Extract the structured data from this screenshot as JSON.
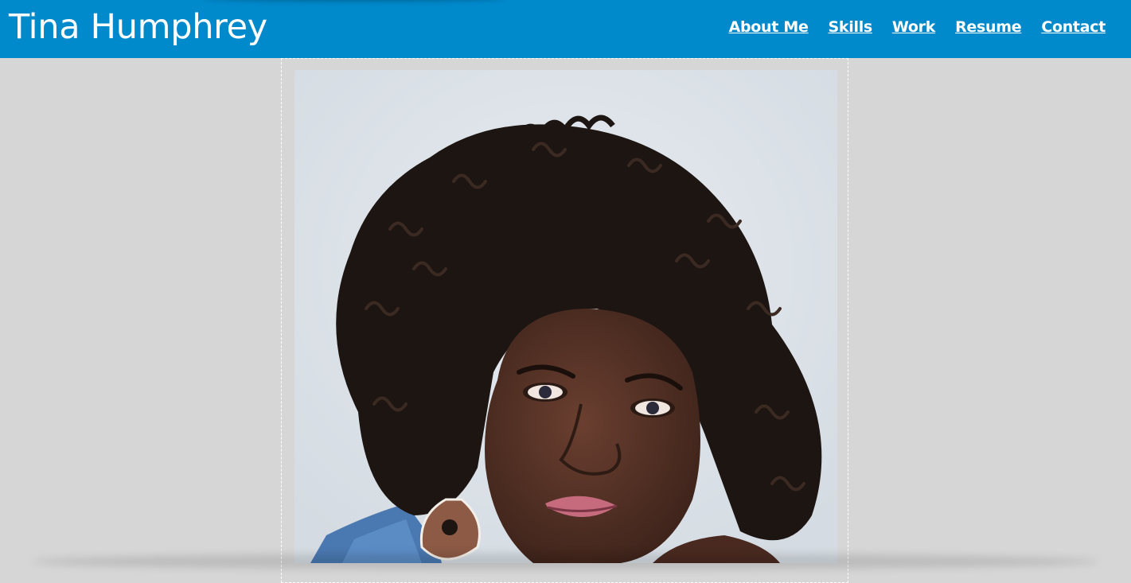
{
  "site": {
    "title": "Tina Humphrey"
  },
  "nav": {
    "items": [
      {
        "label": "About Me"
      },
      {
        "label": "Skills"
      },
      {
        "label": "Work"
      },
      {
        "label": "Resume"
      },
      {
        "label": "Contact"
      }
    ]
  },
  "hero": {
    "image_icon": "portrait-photo"
  },
  "colors": {
    "header": "#0089cb",
    "page_background": "#d6d6d6",
    "header_text": "#ffffff",
    "frame_border": "#ffffff",
    "photo_background": "#dde3e9"
  }
}
